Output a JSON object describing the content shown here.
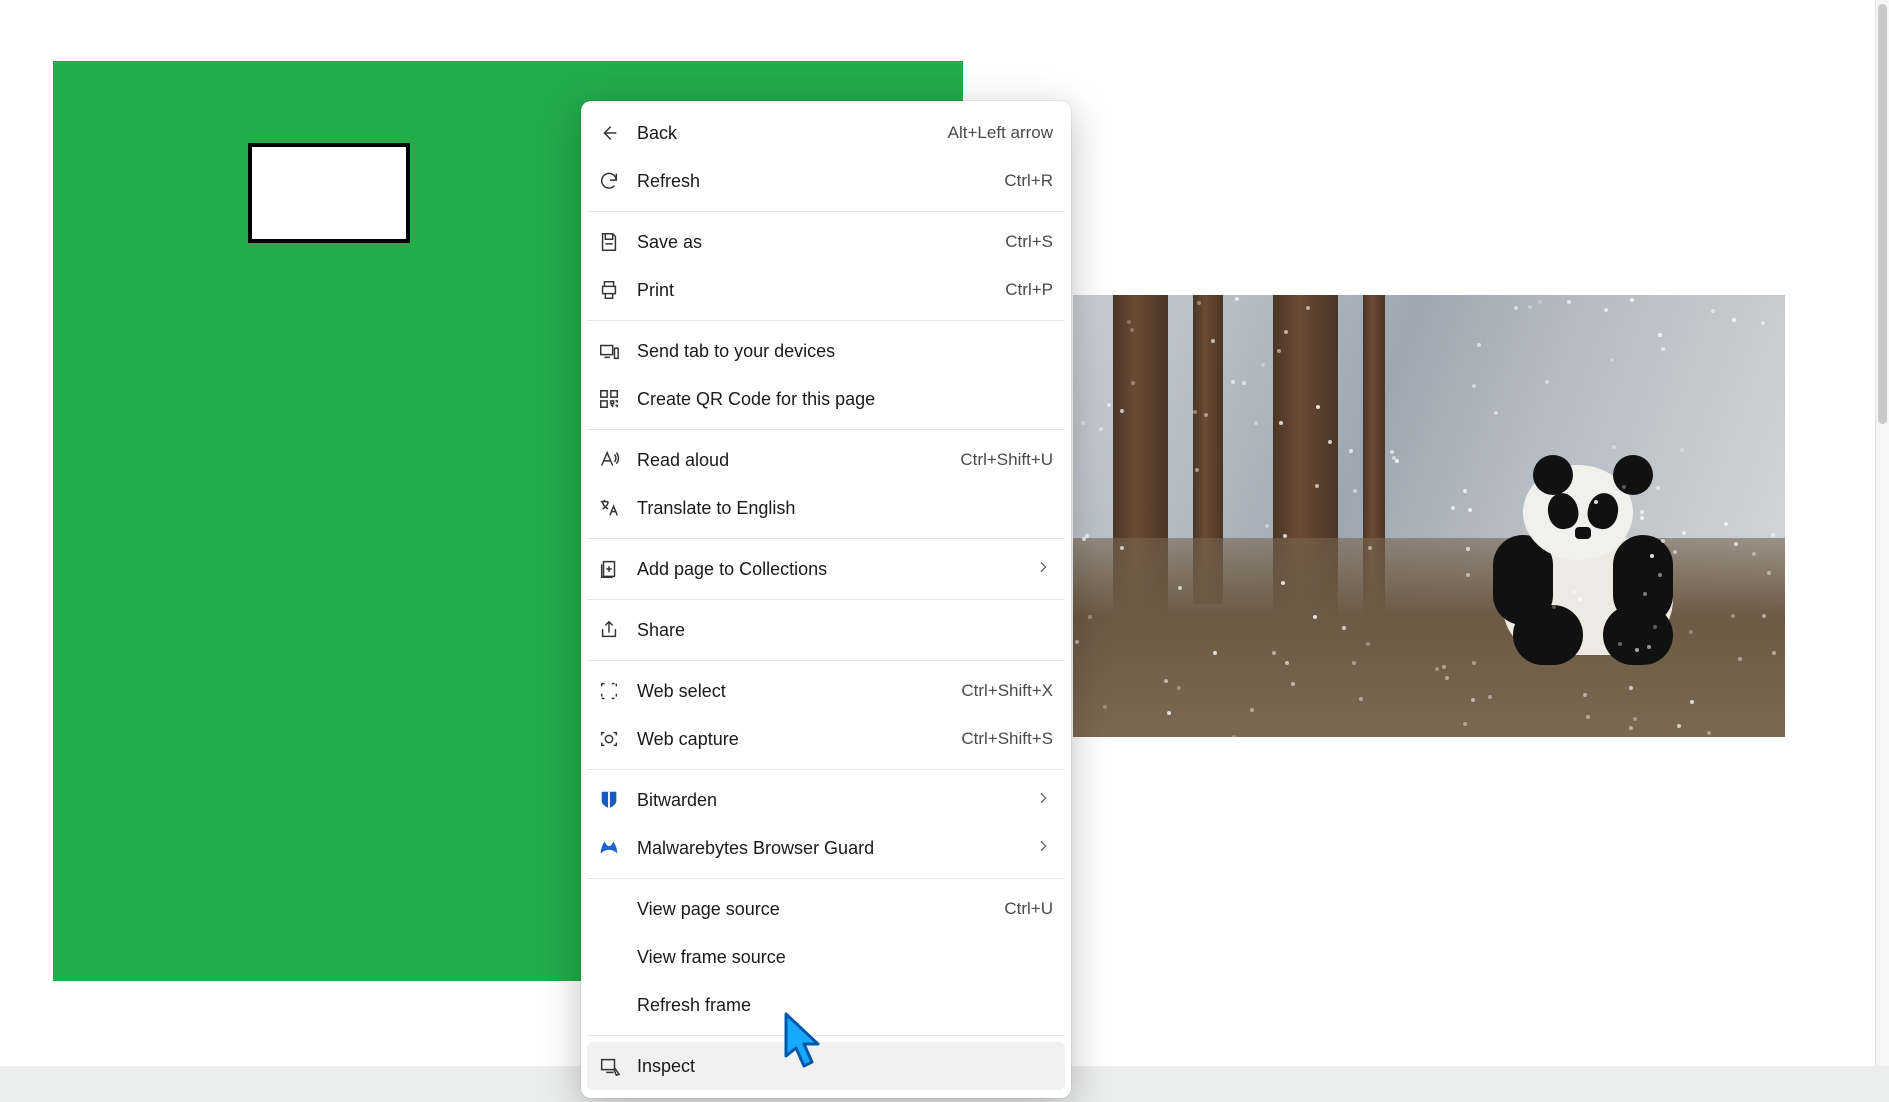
{
  "page": {
    "green_block_color": "#22ac4a",
    "image_alt": "Giant panda sitting among snowy tree trunks"
  },
  "context_menu": {
    "groups": [
      {
        "items": [
          {
            "id": "back",
            "icon": "arrow-left-icon",
            "label": "Back",
            "shortcut": "Alt+Left arrow"
          },
          {
            "id": "refresh",
            "icon": "refresh-icon",
            "label": "Refresh",
            "shortcut": "Ctrl+R"
          }
        ]
      },
      {
        "items": [
          {
            "id": "saveas",
            "icon": "save-icon",
            "label": "Save as",
            "shortcut": "Ctrl+S"
          },
          {
            "id": "print",
            "icon": "print-icon",
            "label": "Print",
            "shortcut": "Ctrl+P"
          }
        ]
      },
      {
        "items": [
          {
            "id": "sendtab",
            "icon": "devices-icon",
            "label": "Send tab to your devices"
          },
          {
            "id": "qr",
            "icon": "qr-icon",
            "label": "Create QR Code for this page"
          }
        ]
      },
      {
        "items": [
          {
            "id": "readaloud",
            "icon": "read-aloud-icon",
            "label": "Read aloud",
            "shortcut": "Ctrl+Shift+U"
          },
          {
            "id": "translate",
            "icon": "translate-icon",
            "label": "Translate to English"
          }
        ]
      },
      {
        "items": [
          {
            "id": "collections",
            "icon": "collections-icon",
            "label": "Add page to Collections",
            "submenu": true
          }
        ]
      },
      {
        "items": [
          {
            "id": "share",
            "icon": "share-icon",
            "label": "Share"
          }
        ]
      },
      {
        "items": [
          {
            "id": "webselect",
            "icon": "web-select-icon",
            "label": "Web select",
            "shortcut": "Ctrl+Shift+X"
          },
          {
            "id": "webcapture",
            "icon": "web-capture-icon",
            "label": "Web capture",
            "shortcut": "Ctrl+Shift+S"
          }
        ]
      },
      {
        "items": [
          {
            "id": "bitwarden",
            "icon": "bitwarden-icon",
            "icon_class": "bitw",
            "label": "Bitwarden",
            "submenu": true
          },
          {
            "id": "malwarebytes",
            "icon": "malwarebytes-icon",
            "icon_class": "mwb",
            "label": "Malwarebytes Browser Guard",
            "submenu": true
          }
        ]
      },
      {
        "items": [
          {
            "id": "viewsource",
            "icon": "",
            "label": "View page source",
            "shortcut": "Ctrl+U"
          },
          {
            "id": "viewframesource",
            "icon": "",
            "label": "View frame source"
          },
          {
            "id": "refreshframe",
            "icon": "",
            "label": "Refresh frame"
          }
        ]
      },
      {
        "items": [
          {
            "id": "inspect",
            "icon": "inspect-icon",
            "label": "Inspect",
            "hover": true
          }
        ]
      }
    ]
  }
}
